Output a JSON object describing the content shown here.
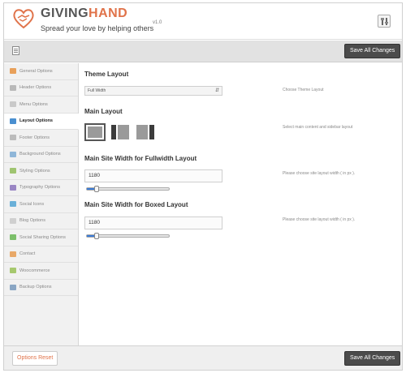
{
  "header": {
    "brand_part1": "GIVING",
    "brand_part2": "HAND",
    "tagline": "Spread your love by helping others",
    "version": "v1.0",
    "brand_accent_color": "#e0734a",
    "tools_icon": "tools-icon"
  },
  "toolbar": {
    "menu_icon": "document-list-icon",
    "save_label": "Save All Changes"
  },
  "sidebar": {
    "items": [
      {
        "label": "General Options",
        "icon": "home-icon",
        "active": false
      },
      {
        "label": "Header Options",
        "icon": "header-layout-icon",
        "active": false
      },
      {
        "label": "Menu Options",
        "icon": "menu-icon",
        "active": false
      },
      {
        "label": "Layout Options",
        "icon": "layout-icon",
        "active": true
      },
      {
        "label": "Footer Options",
        "icon": "footer-layout-icon",
        "active": false
      },
      {
        "label": "Background Options",
        "icon": "background-icon",
        "active": false
      },
      {
        "label": "Styling Options",
        "icon": "brush-icon",
        "active": false
      },
      {
        "label": "Typography Options",
        "icon": "pen-icon",
        "active": false
      },
      {
        "label": "Social Icons",
        "icon": "share-icon",
        "active": false
      },
      {
        "label": "Blog Options",
        "icon": "blog-icon",
        "active": false
      },
      {
        "label": "Social Sharing Options",
        "icon": "social-share-icon",
        "active": false
      },
      {
        "label": "Contact",
        "icon": "contact-icon",
        "active": false
      },
      {
        "label": "Woocommerce",
        "icon": "woocommerce-icon",
        "active": false
      },
      {
        "label": "Backup Options",
        "icon": "backup-icon",
        "active": false
      }
    ]
  },
  "main": {
    "theme_layout": {
      "title": "Theme Layout",
      "selected": "Full Width",
      "description": "Choose Theme Layout"
    },
    "main_layout": {
      "title": "Main Layout",
      "description": "Select main content and sidebar layout",
      "options": [
        "full-width-layout-icon",
        "left-sidebar-layout-icon",
        "right-sidebar-layout-icon"
      ],
      "selected_index": 0
    },
    "fullwidth": {
      "title": "Main Site Width for Fullwidth Layout",
      "value": "1180",
      "description": "Please choose site layout width ( in px ).",
      "slider_fraction": 0.12
    },
    "boxed": {
      "title": "Main Site Width for Boxed Layout",
      "value": "1180",
      "description": "Please choose site layout width ( in px ).",
      "slider_fraction": 0.12
    }
  },
  "footer": {
    "reset_label": "Options Reset",
    "save_label": "Save All Changes"
  }
}
